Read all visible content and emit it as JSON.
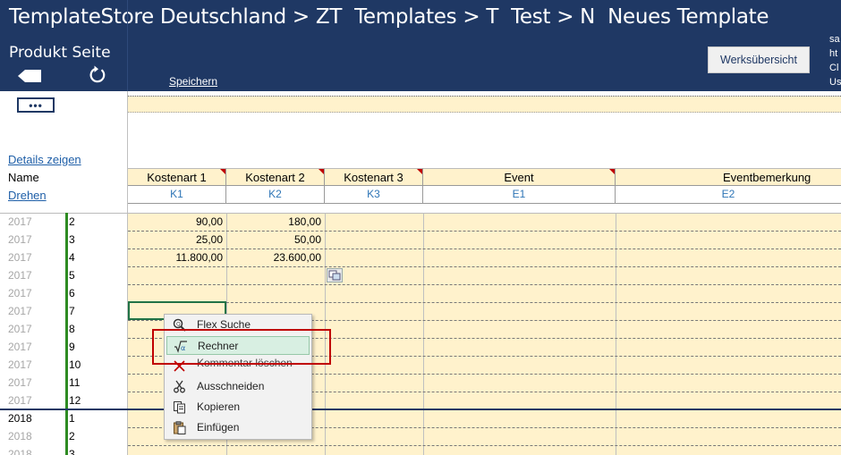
{
  "header": {
    "breadcrumb": "TemplateStore Deutschland > ZT  Templates > T  Test > N  Neues Template",
    "subtitle": "Produkt Seite",
    "save_label": "Speichern",
    "overview_button": "Werksübersicht",
    "side_info": "sa\nht\nCl\nUs"
  },
  "left": {
    "more_button": "•••",
    "details_link": "Details zeigen",
    "name_label": "Name",
    "rotate_link": "Drehen"
  },
  "columns": [
    {
      "title": "Kostenart 1",
      "code": "K1"
    },
    {
      "title": "Kostenart 2",
      "code": "K2"
    },
    {
      "title": "Kostenart 3",
      "code": "K3"
    },
    {
      "title": "Event",
      "code": "E1"
    },
    {
      "title": "Eventbemerkung",
      "code": "E2"
    }
  ],
  "rows": [
    {
      "year": "2017",
      "month": "2",
      "k1": "90,00",
      "k2": "180,00"
    },
    {
      "year": "2017",
      "month": "3",
      "k1": "25,00",
      "k2": "50,00"
    },
    {
      "year": "2017",
      "month": "4",
      "k1": "11.800,00",
      "k2": "23.600,00"
    },
    {
      "year": "2017",
      "month": "5",
      "k1": "",
      "k2": ""
    },
    {
      "year": "2017",
      "month": "6",
      "k1": "",
      "k2": ""
    },
    {
      "year": "2017",
      "month": "7",
      "k1": "",
      "k2": ""
    },
    {
      "year": "2017",
      "month": "8",
      "k1": "",
      "k2": ""
    },
    {
      "year": "2017",
      "month": "9",
      "k1": "",
      "k2": ""
    },
    {
      "year": "2017",
      "month": "10",
      "k1": "",
      "k2": ""
    },
    {
      "year": "2017",
      "month": "11",
      "k1": "",
      "k2": ""
    },
    {
      "year": "2017",
      "month": "12",
      "k1": "",
      "k2": ""
    },
    {
      "year": "2018",
      "month": "1",
      "k1": "",
      "k2": ""
    },
    {
      "year": "2018",
      "month": "2",
      "k1": "",
      "k2": ""
    },
    {
      "year": "2018",
      "month": "3",
      "k1": "",
      "k2": ""
    }
  ],
  "context_menu": {
    "items": [
      {
        "label": "Flex Suche",
        "icon": "search-zoom-icon"
      },
      {
        "label": "Rechner",
        "icon": "calculator-sqrt-icon"
      },
      {
        "label": "Kommentar löschen",
        "icon": "delete-comment-icon"
      },
      {
        "label": "Ausschneiden",
        "icon": "scissors-icon"
      },
      {
        "label": "Kopieren",
        "icon": "copy-icon"
      },
      {
        "label": "Einfügen",
        "icon": "paste-icon"
      }
    ]
  },
  "colors": {
    "header_bg": "#1f3864",
    "cell_bg": "#fff2cc",
    "accent_green": "#2e8b22",
    "highlight_red": "#c00000"
  }
}
